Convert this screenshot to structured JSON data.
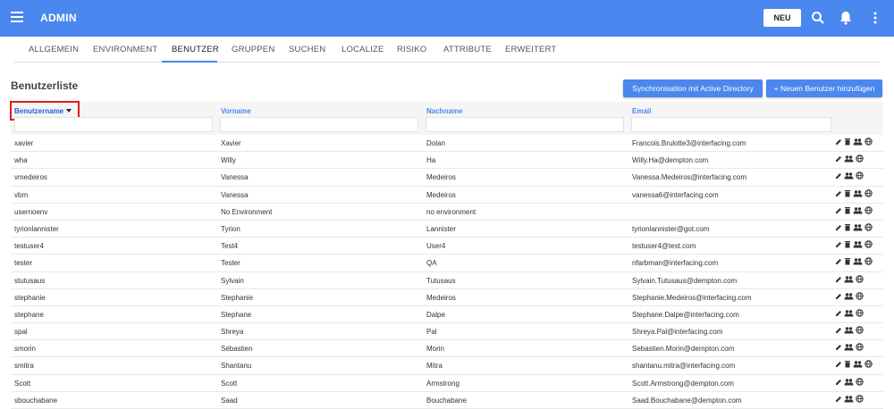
{
  "app": {
    "title": "ADMIN",
    "new_label": "NEU",
    "brand_color": "#4a87ee"
  },
  "tabs": [
    {
      "label": "ALLGEMEIN"
    },
    {
      "label": "ENVIRONMENT"
    },
    {
      "label": "BENUTZER"
    },
    {
      "label": "GRUPPEN"
    },
    {
      "label": "SUCHEN"
    },
    {
      "label": "LOCALIZE"
    },
    {
      "label": "RISIKO"
    },
    {
      "label": "ATTRIBUTE"
    },
    {
      "label": "ERWEITERT"
    }
  ],
  "list": {
    "title": "Benutzerliste",
    "sync_label": "Synchronisation mit Active Directory",
    "add_label": "+ Neuen Benutzer hinzufügen"
  },
  "columns": {
    "username": "Benutzername",
    "firstname": "Vorname",
    "lastname": "Nachname",
    "email": "Email"
  },
  "rows": [
    {
      "u": "xavier",
      "f": "Xavier",
      "l": "Dolan",
      "e": "Francois.Brulotte3@interfacing.com",
      "actions": [
        "edit",
        "delete",
        "group",
        "globe"
      ]
    },
    {
      "u": "wha",
      "f": "Willy",
      "l": "Ha",
      "e": "Willy.Ha@dempton.com",
      "actions": [
        "edit",
        "group",
        "globe"
      ]
    },
    {
      "u": "vmedeiros",
      "f": "Vanessa",
      "l": "Medeiros",
      "e": "Vanessa.Medeiros@interfacing.com",
      "actions": [
        "edit",
        "group",
        "globe"
      ]
    },
    {
      "u": "vbm",
      "f": "Vanessa",
      "l": "Medeiros",
      "e": "vanessa6@interfacing.com",
      "actions": [
        "edit",
        "delete",
        "group",
        "globe"
      ]
    },
    {
      "u": "usernoenv",
      "f": "No Environment",
      "l": "no environment",
      "e": "",
      "actions": [
        "edit",
        "delete",
        "group",
        "globe"
      ]
    },
    {
      "u": "tyrionlannister",
      "f": "Tyrion",
      "l": "Lannister",
      "e": "tyrionlannister@got.com",
      "actions": [
        "edit",
        "delete",
        "group",
        "globe"
      ]
    },
    {
      "u": "testuser4",
      "f": "Test4",
      "l": "User4",
      "e": "testuser4@test.com",
      "actions": [
        "edit",
        "delete",
        "group",
        "globe"
      ]
    },
    {
      "u": "tester",
      "f": "Tester",
      "l": "QA",
      "e": "nfarbman@interfacing.com",
      "actions": [
        "edit",
        "delete",
        "group",
        "globe"
      ]
    },
    {
      "u": "stutusaus",
      "f": "Sylvain",
      "l": "Tutusaus",
      "e": "Sylvain.Tutusaus@dempton.com",
      "actions": [
        "edit",
        "group",
        "globe"
      ]
    },
    {
      "u": "stephanie",
      "f": "Stephanie",
      "l": "Medeiros",
      "e": "Stephanie.Medeiros@interfacing.com",
      "actions": [
        "edit",
        "group",
        "globe"
      ]
    },
    {
      "u": "stephane",
      "f": "Stephane",
      "l": "Dalpe",
      "e": "Stephane.Dalpe@interfacing.com",
      "actions": [
        "edit",
        "group",
        "globe"
      ]
    },
    {
      "u": "spal",
      "f": "Shreya",
      "l": "Pal",
      "e": "Shreya.Pal@interfacing.com",
      "actions": [
        "edit",
        "group",
        "globe"
      ]
    },
    {
      "u": "smorin",
      "f": "Sébastien",
      "l": "Morin",
      "e": "Sebastien.Morin@dempton.com",
      "actions": [
        "edit",
        "group",
        "globe"
      ]
    },
    {
      "u": "smitra",
      "f": "Shantanu",
      "l": "Mitra",
      "e": "shantanu.mitra@interfacing.com",
      "actions": [
        "edit",
        "delete",
        "group",
        "globe"
      ]
    },
    {
      "u": "Scott",
      "f": "Scott",
      "l": "Armstrong",
      "e": "Scott.Armstrong@dempton.com",
      "actions": [
        "edit",
        "group",
        "globe"
      ]
    },
    {
      "u": "sbouchabane",
      "f": "Saad",
      "l": "Bouchabane",
      "e": "Saad.Bouchabane@dempton.com",
      "actions": [
        "edit",
        "group",
        "globe"
      ]
    }
  ]
}
